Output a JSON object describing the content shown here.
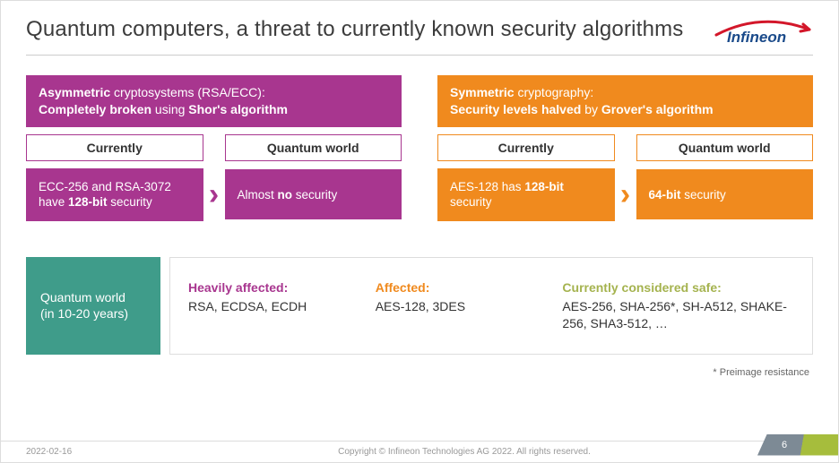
{
  "title": "Quantum computers, a threat to currently known security algorithms",
  "logo_text": "Infineon",
  "asym": {
    "header_html": "<b>Asymmetric</b> cryptosystems (RSA/ECC):<br><b>Completely broken</b> using <b>Shor's algorithm</b>",
    "label_current": "Currently",
    "label_quantum": "Quantum world",
    "box_current_html": "ECC-256 and RSA-3072 have <b>128-bit</b> security",
    "box_quantum_html": "Almost <b>no</b> security"
  },
  "sym": {
    "header_html": "<b>Symmetric</b> cryptography:<br><b>Security levels halved</b> by <b>Grover's algorithm</b>",
    "label_current": "Currently",
    "label_quantum": "Quantum world",
    "box_current_html": "AES-128 has <b>128-bit</b> security",
    "box_quantum_html": "<b>64-bit</b> security"
  },
  "summary": {
    "left_html": "Quantum world<br>(in 10-20 years)",
    "heavy_title": "Heavily affected:",
    "heavy_list": "RSA, ECDSA, ECDH",
    "affected_title": "Affected:",
    "affected_list": "AES-128, 3DES",
    "safe_title": "Currently considered safe:",
    "safe_list": "AES-256, SHA-256*, SH-A512, SHAKE-256, SHA3-512, …"
  },
  "footnote": "* Preimage resistance",
  "footer": {
    "date": "2022-02-16",
    "copyright": "Copyright © Infineon Technologies AG 2022. All rights reserved.",
    "page": "6"
  }
}
